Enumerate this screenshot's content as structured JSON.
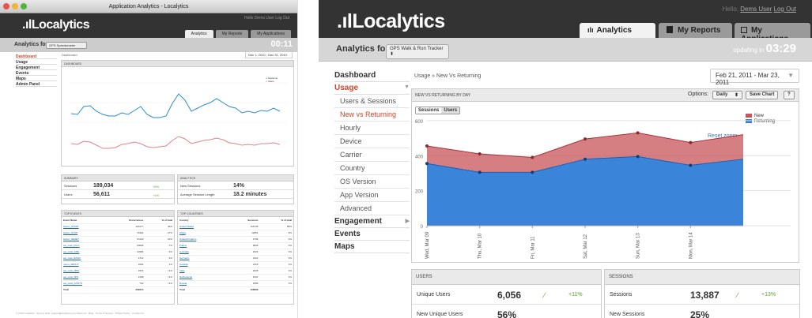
{
  "colors": {
    "brand_header": "#333333",
    "active_nav": "#d3432b",
    "new_series": "#c8545a",
    "returning_series": "#2f7ed8",
    "positive": "#5aa02c",
    "line_blue": "#2b8bd0",
    "line_red": "#e08585"
  },
  "left_window": {
    "title": "Application Analytics - Localytics",
    "logo": ".ılLocalytics",
    "hello": "Hello Dems User Log Out",
    "tabs": [
      "Analytics",
      "My Reports",
      "My Applications"
    ],
    "analytics_for": "Analytics for:",
    "app_select": "GPS Speedometer",
    "updating": "00:11",
    "nav": [
      "Dashboard",
      "Usage",
      "Engagement",
      "Events",
      "Maps",
      "Admin Panel"
    ],
    "crumb": "Dashboard",
    "date_range": "Dec 1, 2010 - Dec 31, 2010",
    "chart_title": "DASHBOARD",
    "legend": [
      "Sessions",
      "Users"
    ],
    "summary": {
      "title": "SUMMARY",
      "rows": [
        {
          "label": "Sessions",
          "value": "189,034",
          "pct": "+5%"
        },
        {
          "label": "Users",
          "value": "56,611",
          "pct": "+1%"
        }
      ]
    },
    "analytics": {
      "title": "ANALYTICS",
      "rows": [
        {
          "label": "New Sessions",
          "value": "14%"
        },
        {
          "label": "Average Session Length",
          "value": "18.2 minutes"
        }
      ]
    },
    "top_events": {
      "title": "TOP EVENTS",
      "headers": [
        "Event Name",
        "Occurrences",
        "% of total"
      ],
      "rows": [
        [
          "button_START",
          "123177",
          "46%"
        ],
        [
          "button_STOP",
          "71992",
          "27%"
        ],
        [
          "button_RESET",
          "27229",
          "10%"
        ],
        [
          "set_view_FULL",
          "20099",
          "7%"
        ],
        [
          "set_units_KMH",
          "14984",
          "6%"
        ],
        [
          "set_view_BASIC",
          "4712",
          "2%"
        ],
        [
          "menu_ABOUT",
          "3494",
          "1%"
        ],
        [
          "set_units_MPH",
          "1516",
          "<1%"
        ],
        [
          "set_units_M/S",
          "1368",
          "<1%"
        ],
        [
          "set_units_KNOTS",
          "792",
          "<1%"
        ],
        [
          "Total",
          "269313",
          ""
        ]
      ]
    },
    "top_countries": {
      "title": "TOP COUNTRIES",
      "headers": [
        "Country",
        "Sessions",
        "% of total"
      ],
      "rows": [
        [
          "United States",
          "116735",
          "58%"
        ],
        [
          "China",
          "12851",
          "6%"
        ],
        [
          "United Kingdom",
          "4796",
          "3%"
        ],
        [
          "France",
          "3846",
          "3%"
        ],
        [
          "Australia",
          "2524",
          "2%"
        ],
        [
          "Germany",
          "2321",
          "2%"
        ],
        [
          "Canada",
          "2115",
          "1%"
        ],
        [
          "India",
          "2028",
          "1%"
        ],
        [
          "Netherlands",
          "1601",
          "1%"
        ],
        [
          "Russia",
          "1589",
          "1%"
        ],
        [
          "Total",
          "156899",
          ""
        ]
      ]
    },
    "footer": "© 2010 Localytics · Send a Note: support@localytics.com        About Us · Blog · Terms of Service · Privacy Policy · Contact Us"
  },
  "header": {
    "logo": ".ılLocalytics",
    "hello_prefix": "Hello,",
    "user": "Dems User",
    "logout": "Log Out"
  },
  "tabs": [
    {
      "icon": "bar-chart-icon",
      "label": "Analytics"
    },
    {
      "icon": "document-icon",
      "label": "My Reports"
    },
    {
      "icon": "square-icon",
      "label": "My Applications"
    }
  ],
  "subheader": {
    "analytics_for": "Analytics for:",
    "app": "GPS Walk & Run Tracker",
    "updating_label": "updating in",
    "timer": "03:29"
  },
  "nav": {
    "main": [
      "Dashboard",
      "Usage",
      "Engagement",
      "Events",
      "Maps"
    ],
    "usage_sub": [
      "Users & Sessions",
      "New vs Returning",
      "Hourly",
      "Device",
      "Carrier",
      "Country",
      "OS Version",
      "App Version",
      "Advanced"
    ]
  },
  "breadcrumb": "Usage » New Vs Returning",
  "date_range": "Feb 21, 2011 - Mar 23, 2011",
  "chart_panel": {
    "title": "NEW VS RETURNING BY DAY",
    "options_label": "Options:",
    "daily": "Daily",
    "save": "Save Chart",
    "help": "?",
    "toggle": [
      "Sessions",
      "Users"
    ],
    "reset_zoom": "Reset zoom"
  },
  "chart_data": {
    "type": "area",
    "stacked": true,
    "categories": [
      "Wed, Mar 09",
      "Thu, Mar 10",
      "Fri, Mar 11",
      "Sat, Mar 12",
      "Sun, Mar 13",
      "Mon, Mar 14"
    ],
    "x": [
      0,
      1,
      2,
      3,
      4,
      5,
      6
    ],
    "series": [
      {
        "name": "Returning",
        "values": [
          355,
          305,
          305,
          380,
          395,
          345,
          380
        ]
      },
      {
        "name": "New",
        "values": [
          100,
          105,
          85,
          115,
          135,
          130,
          140
        ]
      }
    ],
    "yticks": [
      0,
      200,
      400,
      600
    ],
    "ylim": [
      0,
      640
    ],
    "legend": "top-right",
    "grid": true
  },
  "users_tile": {
    "title": "USERS",
    "rows": [
      {
        "label": "Unique Users",
        "value": "6,056",
        "pct": "+11%"
      },
      {
        "label": "New Unique Users",
        "value": "56%"
      }
    ]
  },
  "sessions_tile": {
    "title": "SESSIONS",
    "rows": [
      {
        "label": "Sessions",
        "value": "13,887",
        "pct": "+13%"
      },
      {
        "label": "New Sessions",
        "value": "25%"
      }
    ]
  }
}
